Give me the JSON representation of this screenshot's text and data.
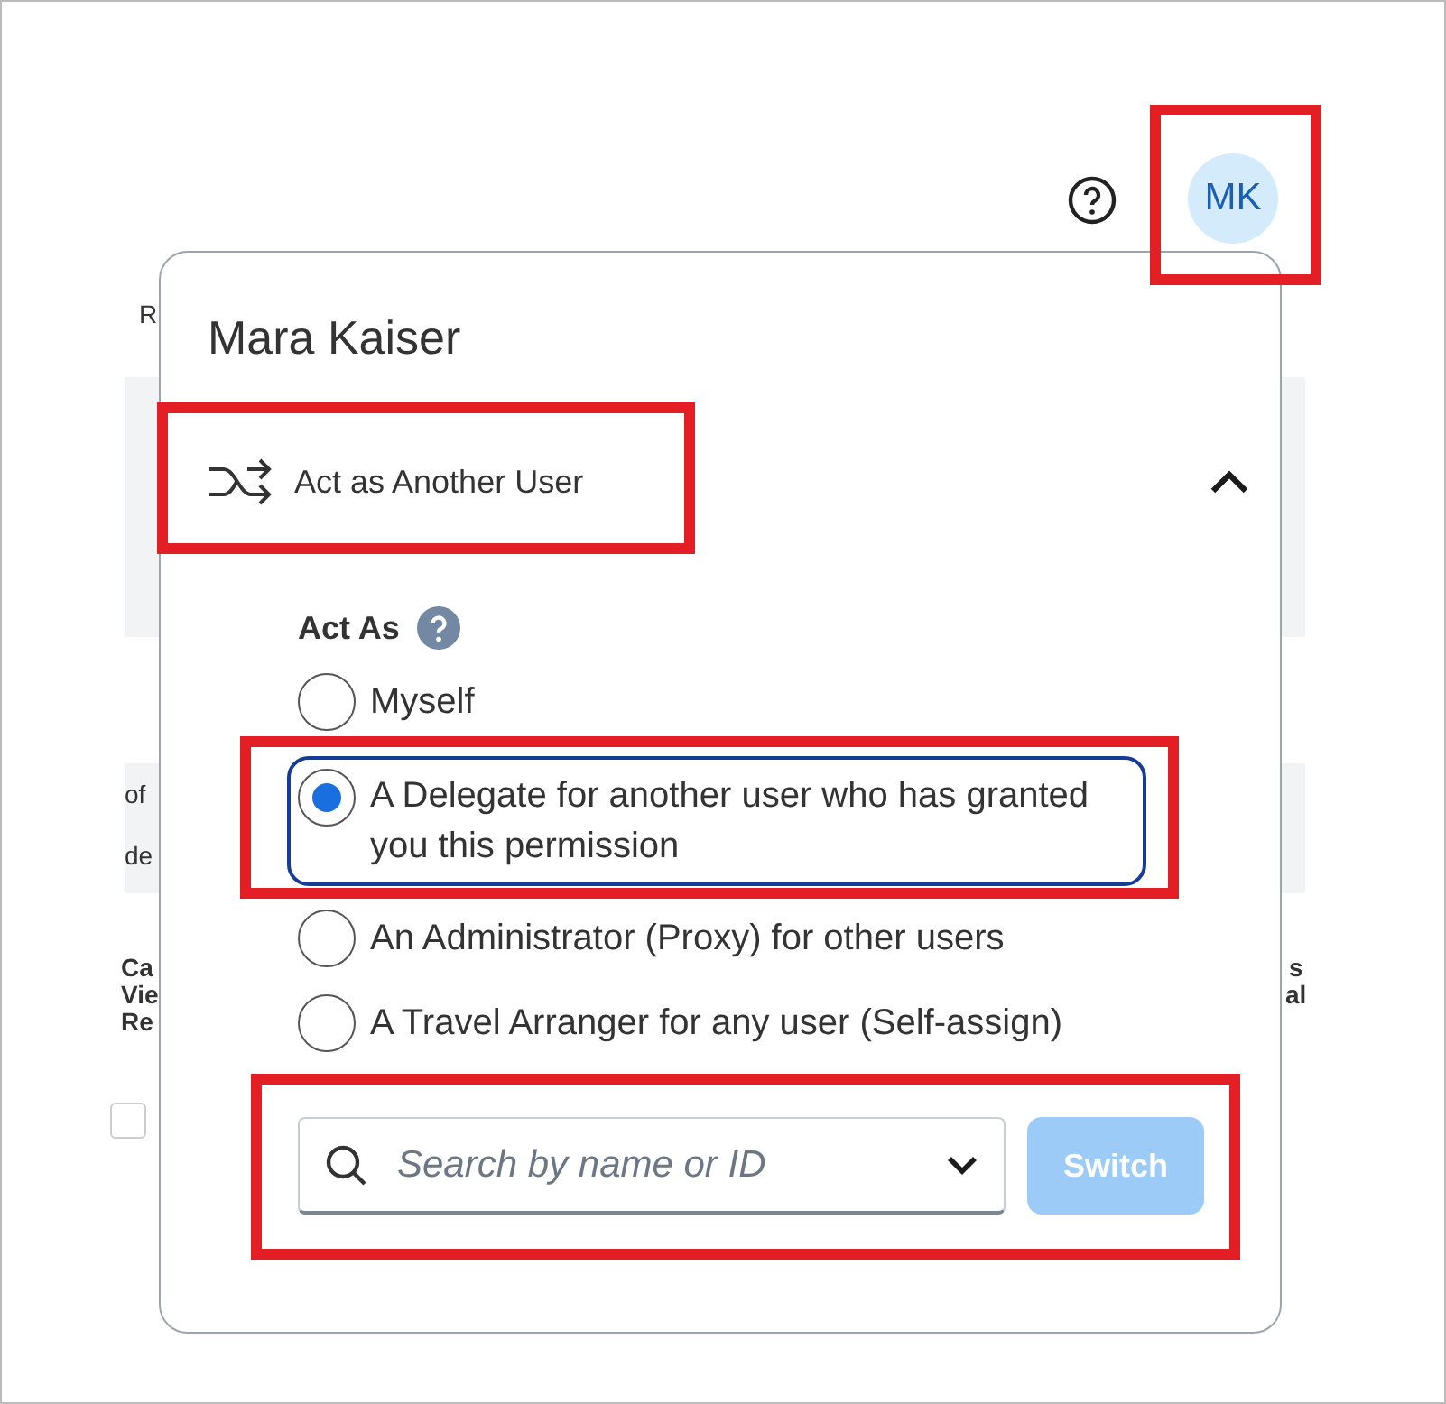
{
  "background_fragments": [
    "R",
    "of",
    "de",
    "Ca",
    "Vie",
    "Re",
    "s",
    "al"
  ],
  "background_checkbox": {
    "checked": false
  },
  "avatar": {
    "initials": "MK"
  },
  "menu": {
    "user_name": "Mara Kaiser",
    "section": {
      "label": "Act as Another User",
      "expanded": true
    },
    "act_as": {
      "label": "Act As",
      "options": [
        {
          "label": "Myself",
          "selected": false
        },
        {
          "label": "A Delegate for another user who has granted you this permission",
          "selected": true
        },
        {
          "label": "An Administrator (Proxy) for other users",
          "selected": false
        },
        {
          "label": "A Travel Arranger for any user (Self-assign)",
          "selected": false
        }
      ]
    },
    "search": {
      "placeholder": "Search by name or ID"
    },
    "switch_button": {
      "label": "Switch",
      "disabled": true
    }
  }
}
